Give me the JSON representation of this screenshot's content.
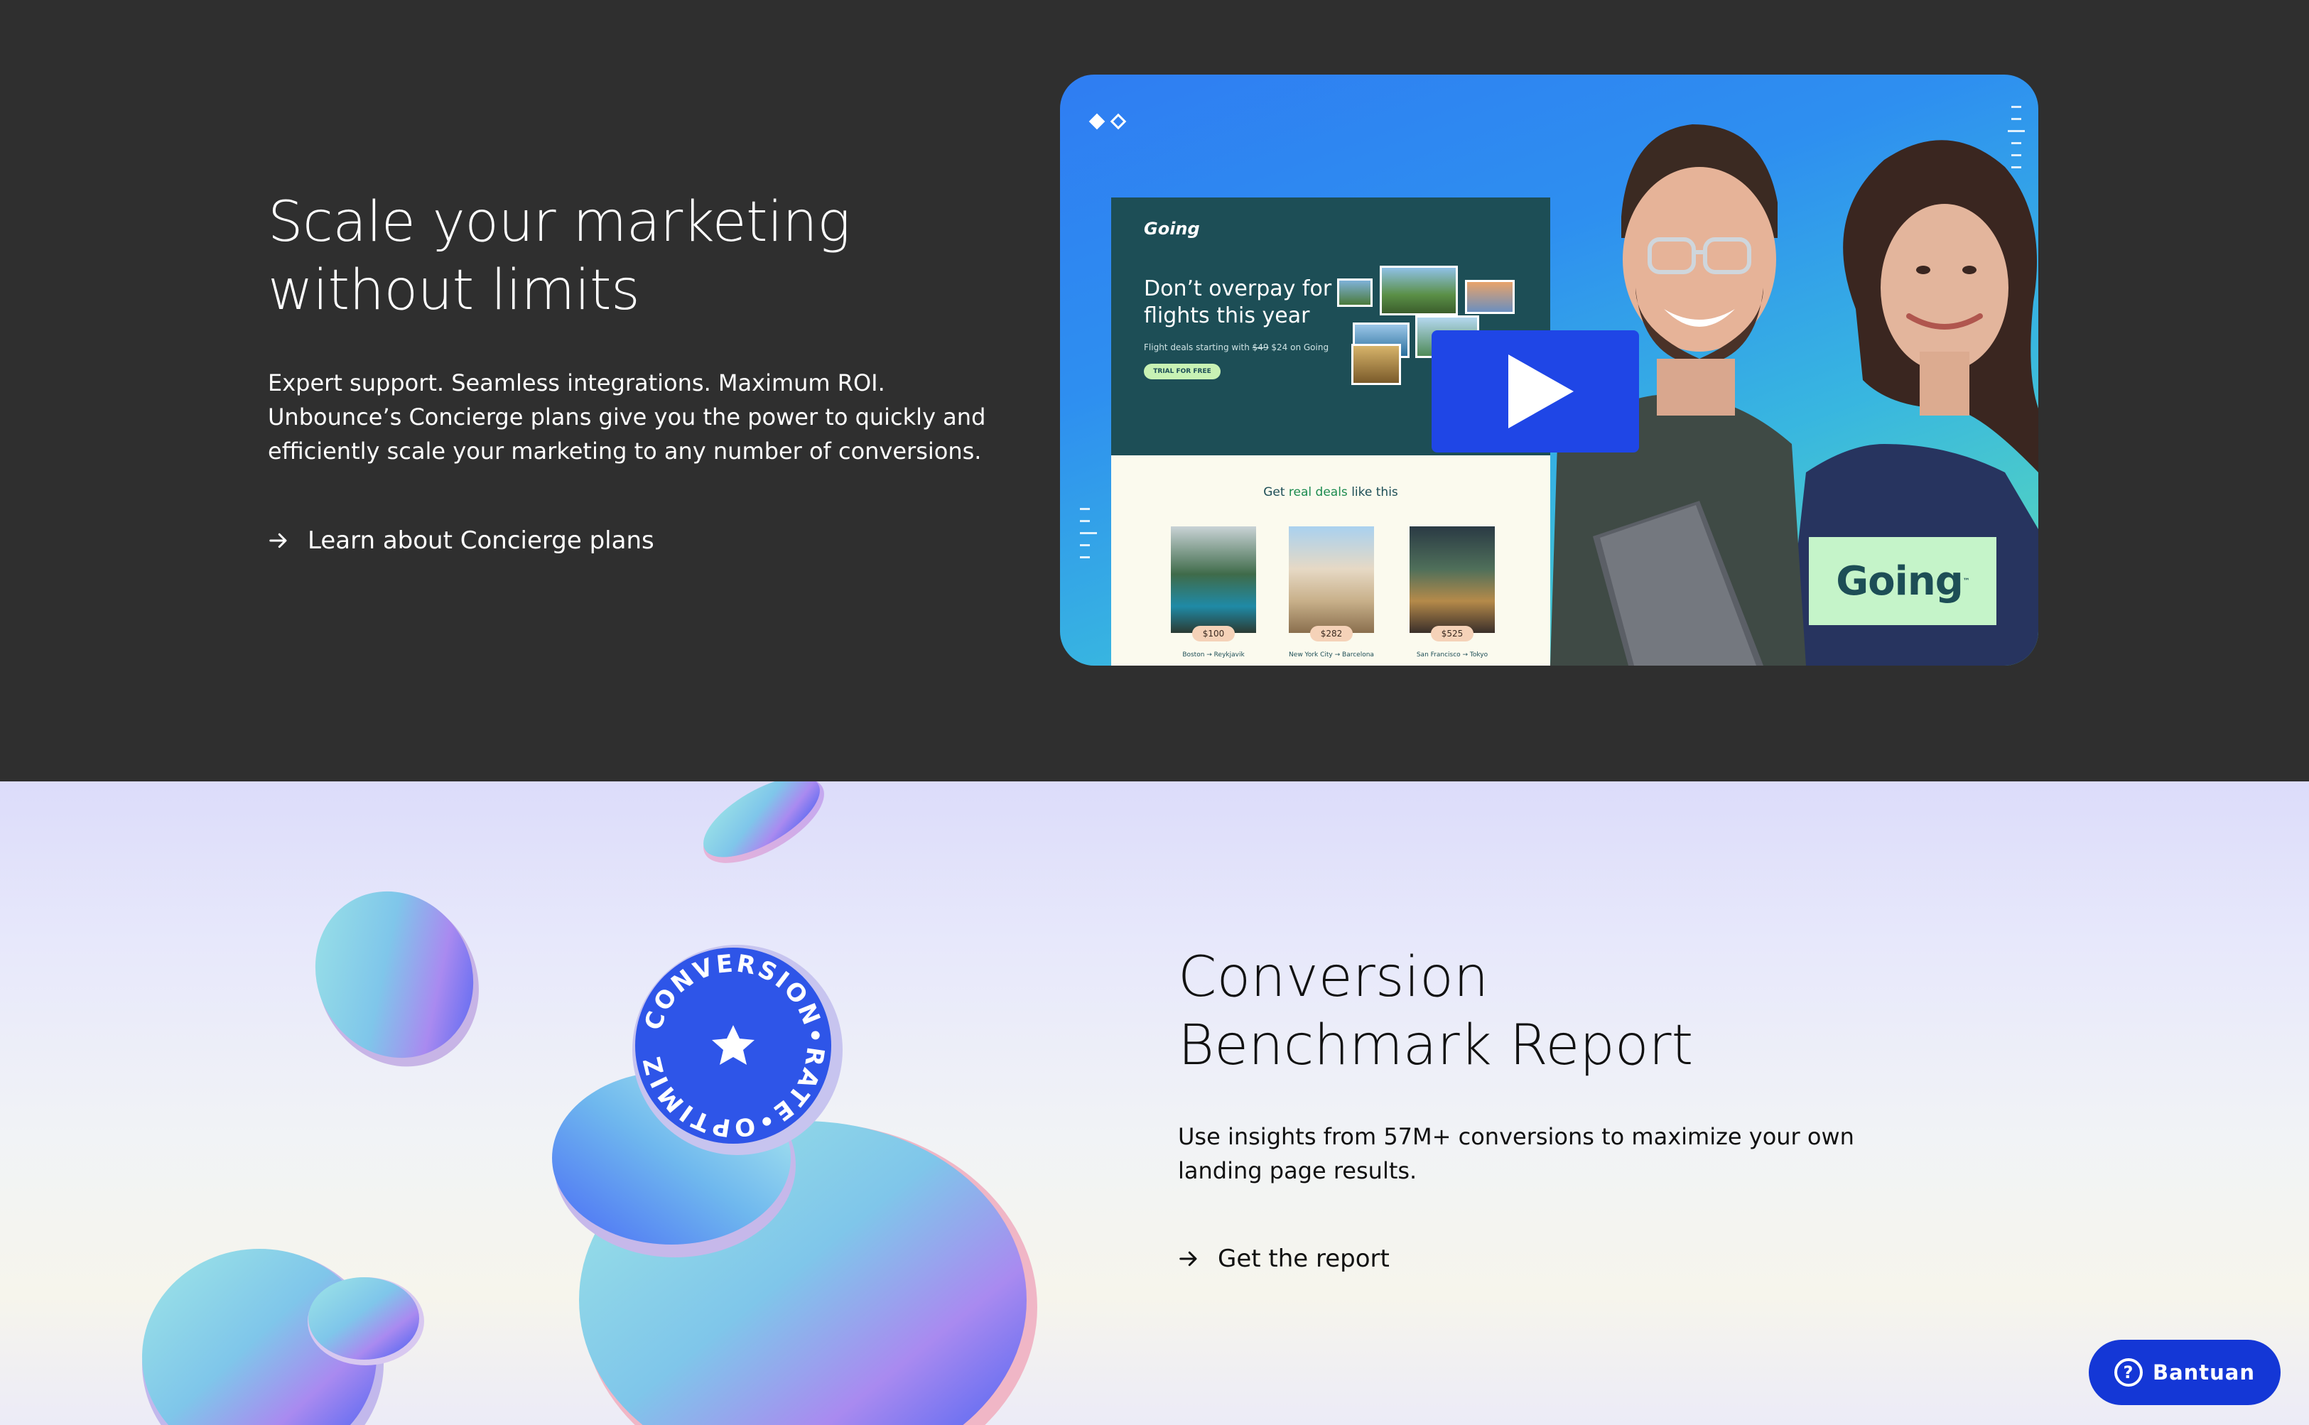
{
  "hero": {
    "title_line1": "Scale your marketing",
    "title_line2": "without limits",
    "body": "Expert support. Seamless integrations. Maximum ROI. Unbounce’s Concierge plans give you the power to quickly and efficiently scale your marketing to any number of conversions.",
    "link_label": "Learn about Concierge plans"
  },
  "video": {
    "landing_page": {
      "logo": "Going",
      "headline": "Don’t overpay for flights this year",
      "sub_prefix": "Flight deals starting with ",
      "sub_strike": "$49",
      "sub_suffix": " $24 on Going",
      "cta": "TRIAL FOR FREE",
      "deals_prefix": "Get ",
      "deals_highlight": "real deals",
      "deals_suffix": " like this",
      "deals": [
        {
          "price": "$100",
          "route": "Boston → Reykjavik"
        },
        {
          "price": "$282",
          "route": "New York City → Barcelona"
        },
        {
          "price": "$525",
          "route": "San Francisco → Tokyo"
        }
      ]
    },
    "badge_text": "Going",
    "badge_tm": "™"
  },
  "report": {
    "title_line1": "Conversion",
    "title_line2": "Benchmark Report",
    "body": "Use insights from 57M+ conversions to maximize your own landing page results.",
    "link_label": "Get the report",
    "seal_text": "CONVERSION•RATE•OPTIMIZATION•"
  },
  "help": {
    "label": "Bantuan",
    "icon_glyph": "?"
  },
  "colors": {
    "dark_bg": "#2f2f2f",
    "help_blue": "#1437d6",
    "play_blue": "#1f46e6",
    "going_green": "#c5f4c9",
    "going_teal": "#1d4e56"
  }
}
